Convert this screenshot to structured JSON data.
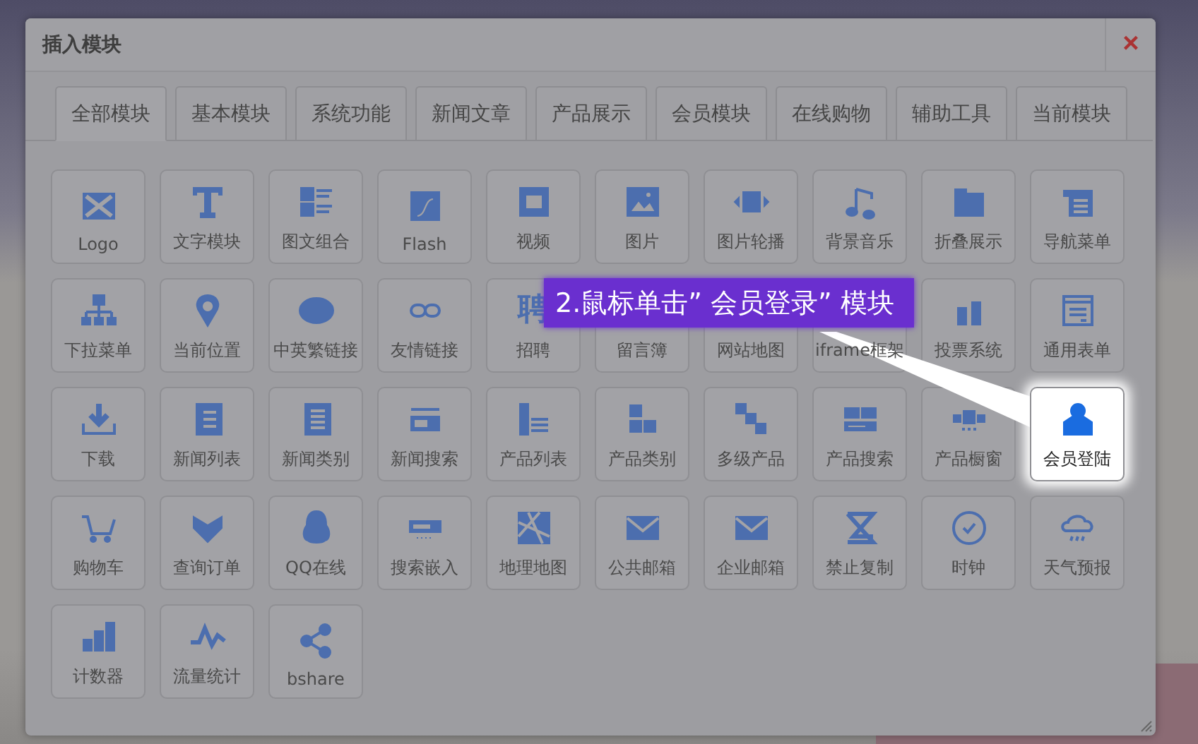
{
  "dialog": {
    "title": "插入模块",
    "close": "×"
  },
  "tabs": [
    {
      "label": "全部模块",
      "selected": true
    },
    {
      "label": "基本模块",
      "selected": false
    },
    {
      "label": "系统功能",
      "selected": false
    },
    {
      "label": "新闻文章",
      "selected": false
    },
    {
      "label": "产品展示",
      "selected": false
    },
    {
      "label": "会员模块",
      "selected": false
    },
    {
      "label": "在线购物",
      "selected": false
    },
    {
      "label": "辅助工具",
      "selected": false
    },
    {
      "label": "当前模块",
      "selected": false
    }
  ],
  "modules": [
    {
      "label": "Logo",
      "highlighted": false
    },
    {
      "label": "文字模块",
      "highlighted": false
    },
    {
      "label": "图文组合",
      "highlighted": false
    },
    {
      "label": "Flash",
      "highlighted": false
    },
    {
      "label": "视频",
      "highlighted": false
    },
    {
      "label": "图片",
      "highlighted": false
    },
    {
      "label": "图片轮播",
      "highlighted": false
    },
    {
      "label": "背景音乐",
      "highlighted": false
    },
    {
      "label": "折叠展示",
      "highlighted": false
    },
    {
      "label": "导航菜单",
      "highlighted": false
    },
    {
      "label": "下拉菜单",
      "highlighted": false
    },
    {
      "label": "当前位置",
      "highlighted": false
    },
    {
      "label": "中英繁链接",
      "highlighted": false
    },
    {
      "label": "友情链接",
      "highlighted": false
    },
    {
      "label": "招聘",
      "highlighted": false,
      "glyph": "聘"
    },
    {
      "label": "留言簿",
      "highlighted": false
    },
    {
      "label": "网站地图",
      "highlighted": false
    },
    {
      "label": "iframe框架",
      "highlighted": false
    },
    {
      "label": "投票系统",
      "highlighted": false
    },
    {
      "label": "通用表单",
      "highlighted": false
    },
    {
      "label": "下载",
      "highlighted": false
    },
    {
      "label": "新闻列表",
      "highlighted": false
    },
    {
      "label": "新闻类别",
      "highlighted": false
    },
    {
      "label": "新闻搜索",
      "highlighted": false
    },
    {
      "label": "产品列表",
      "highlighted": false
    },
    {
      "label": "产品类别",
      "highlighted": false
    },
    {
      "label": "多级产品",
      "highlighted": false
    },
    {
      "label": "产品搜索",
      "highlighted": false
    },
    {
      "label": "产品橱窗",
      "highlighted": false
    },
    {
      "label": "会员登陆",
      "highlighted": true
    },
    {
      "label": "购物车",
      "highlighted": false
    },
    {
      "label": "查询订单",
      "highlighted": false
    },
    {
      "label": "QQ在线",
      "highlighted": false
    },
    {
      "label": "搜索嵌入",
      "highlighted": false
    },
    {
      "label": "地理地图",
      "highlighted": false
    },
    {
      "label": "公共邮箱",
      "highlighted": false
    },
    {
      "label": "企业邮箱",
      "highlighted": false
    },
    {
      "label": "禁止复制",
      "highlighted": false
    },
    {
      "label": "时钟",
      "highlighted": false
    },
    {
      "label": "天气预报",
      "highlighted": false
    },
    {
      "label": "计数器",
      "highlighted": false
    },
    {
      "label": "流量统计",
      "highlighted": false
    },
    {
      "label": "bshare",
      "highlighted": false
    }
  ],
  "callout": {
    "text": "2.鼠标单击” 会员登录” 模块"
  }
}
